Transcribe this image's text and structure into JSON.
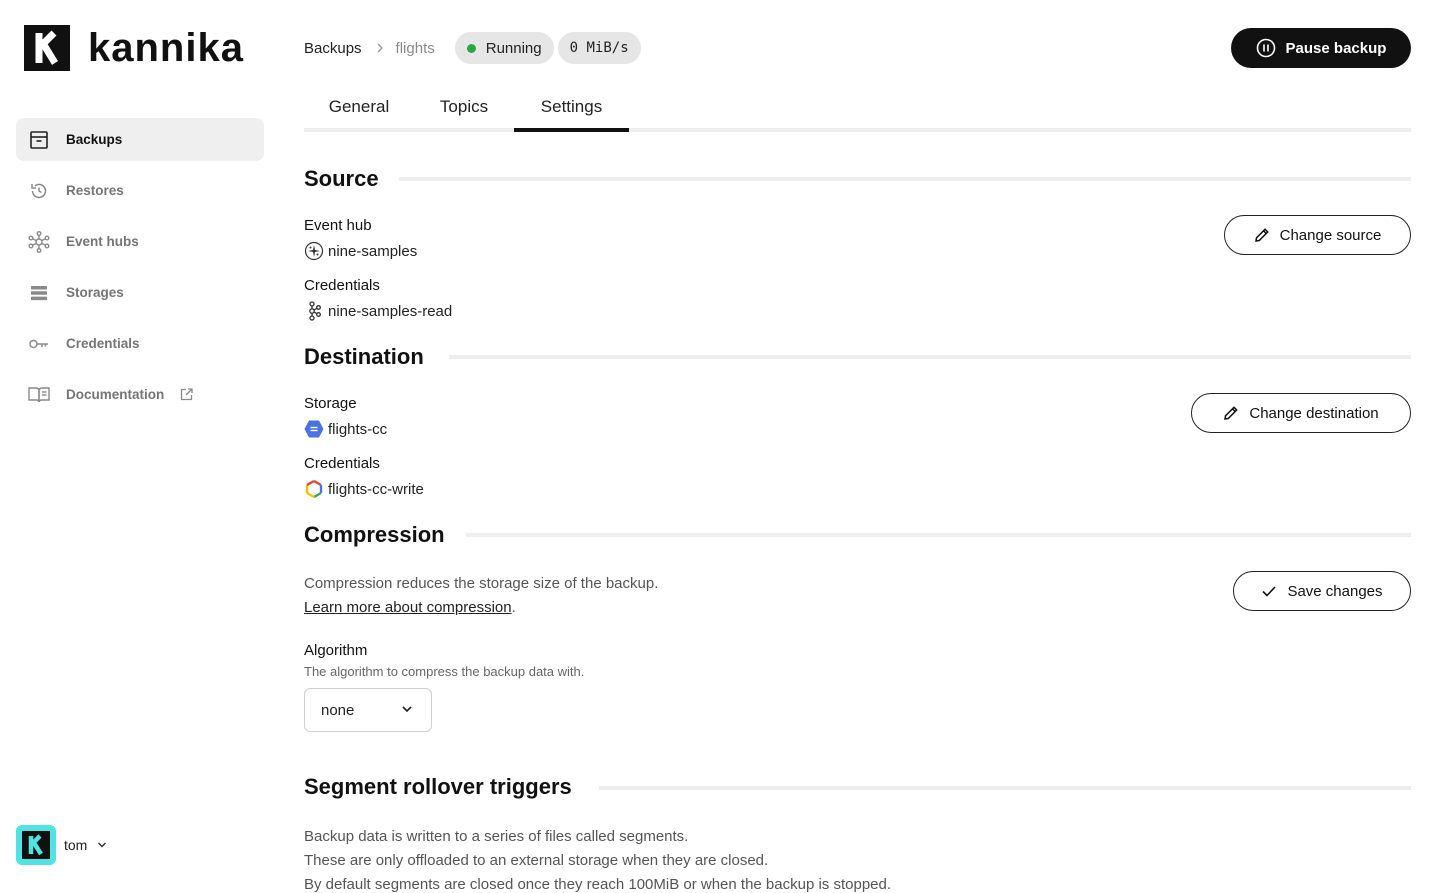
{
  "app": {
    "name": "kannika"
  },
  "sidebar": {
    "items": [
      {
        "label": "Backups",
        "icon": "archive-box-icon",
        "active": true
      },
      {
        "label": "Restores",
        "icon": "history-icon",
        "active": false
      },
      {
        "label": "Event hubs",
        "icon": "hub-network-icon",
        "active": false
      },
      {
        "label": "Storages",
        "icon": "server-stack-icon",
        "active": false
      },
      {
        "label": "Credentials",
        "icon": "key-icon",
        "active": false
      },
      {
        "label": "Documentation",
        "icon": "book-open-icon",
        "active": false,
        "external": true
      }
    ],
    "user": {
      "name": "tom"
    }
  },
  "header": {
    "breadcrumb": {
      "parent": "Backups",
      "current": "flights"
    },
    "status": {
      "label": "Running",
      "color": "#27a844"
    },
    "throughput": "0 MiB/s",
    "pause_button": "Pause backup"
  },
  "tabs": [
    {
      "label": "General",
      "active": false
    },
    {
      "label": "Topics",
      "active": false
    },
    {
      "label": "Settings",
      "active": true
    }
  ],
  "source": {
    "title": "Source",
    "event_hub_label": "Event hub",
    "event_hub_value": "nine-samples",
    "credentials_label": "Credentials",
    "credentials_value": "nine-samples-read",
    "change_button": "Change source"
  },
  "destination": {
    "title": "Destination",
    "storage_label": "Storage",
    "storage_value": "flights-cc",
    "credentials_label": "Credentials",
    "credentials_value": "flights-cc-write",
    "change_button": "Change destination"
  },
  "compression": {
    "title": "Compression",
    "description": "Compression reduces the storage size of the backup.",
    "learn_more": "Learn more about compression",
    "save_button": "Save changes",
    "algorithm_label": "Algorithm",
    "algorithm_helper": "The algorithm to compress the backup data with.",
    "algorithm_value": "none"
  },
  "segments": {
    "title": "Segment rollover triggers",
    "line1": "Backup data is written to a series of files called segments.",
    "line2": "These are only offloaded to an external storage when they are closed.",
    "line3": "By default segments are closed once they reach 100MiB or when the backup is stopped."
  }
}
